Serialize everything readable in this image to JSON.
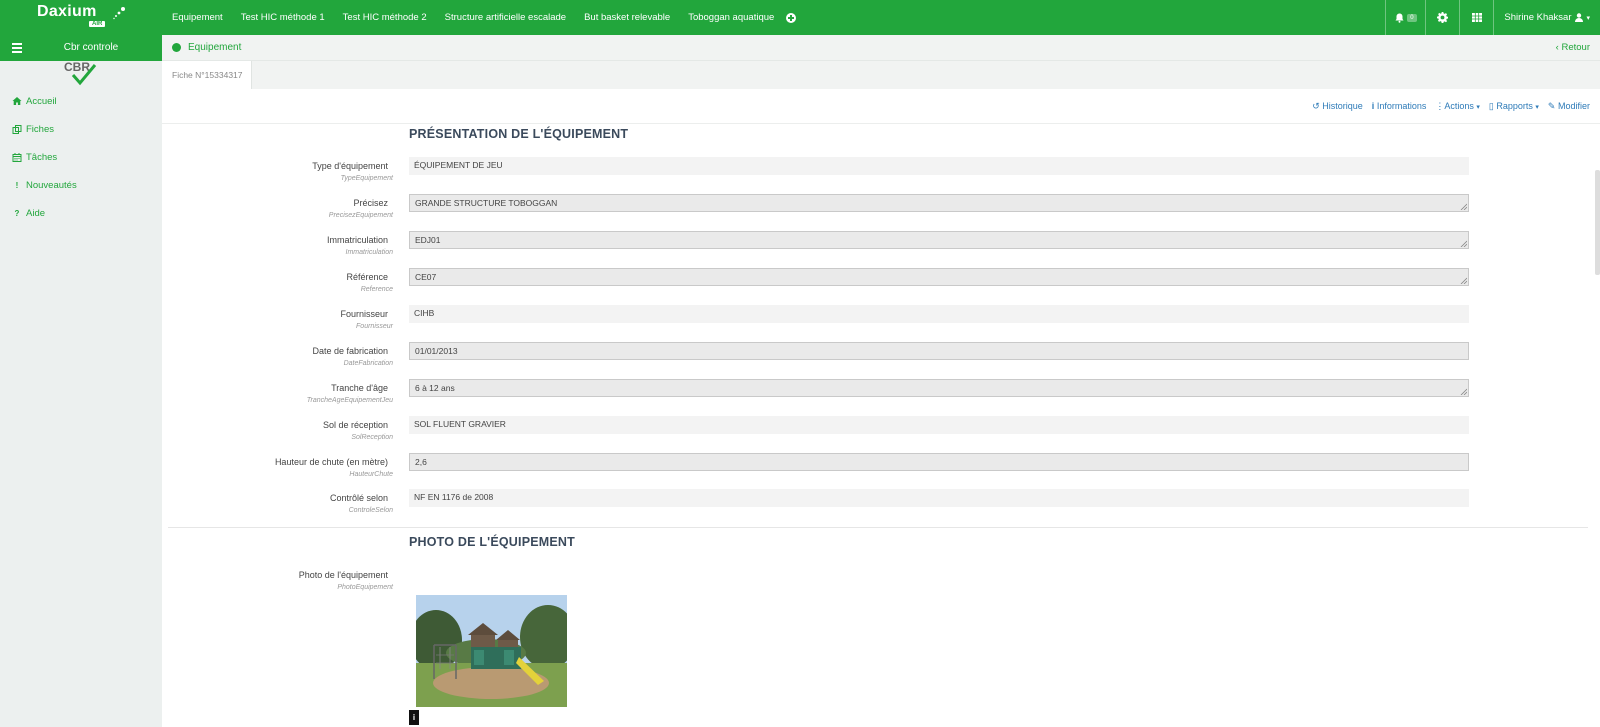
{
  "header": {
    "logo_text": "Daxium",
    "logo_badge": "AIR",
    "nav": [
      "Equipement",
      "Test HIC méthode 1",
      "Test HIC méthode 2",
      "Structure artificielle escalade",
      "But basket relevable",
      "Toboggan aquatique"
    ],
    "notification_count": "0",
    "user_name": "Shirine Khaksar"
  },
  "sidebar": {
    "company": "Cbr controle",
    "logo_text": "CBR",
    "items": [
      {
        "label": "Accueil",
        "icon": "home-icon"
      },
      {
        "label": "Fiches",
        "icon": "copy-icon"
      },
      {
        "label": "Tâches",
        "icon": "calendar-icon"
      },
      {
        "label": "Nouveautés",
        "icon": "exclamation-icon"
      },
      {
        "label": "Aide",
        "icon": "question-icon"
      }
    ]
  },
  "breadcrumb": {
    "title": "Equipement",
    "back": "Retour"
  },
  "record": {
    "tab": "Fiche N°15334317"
  },
  "actions": {
    "historique": "Historique",
    "informations": "Informations",
    "actions": "Actions",
    "rapports": "Rapports",
    "modifier": "Modifier"
  },
  "section1": {
    "title": "PRÉSENTATION DE L'ÉQUIPEMENT",
    "fields": [
      {
        "label": "Type d'équipement",
        "sub": "TypeEquipement",
        "value": "ÉQUIPEMENT DE JEU"
      },
      {
        "label": "Précisez",
        "sub": "PrecisezEquipement",
        "value": "GRANDE STRUCTURE TOBOGGAN"
      },
      {
        "label": "Immatriculation",
        "sub": "Immatriculation",
        "value": "EDJ01"
      },
      {
        "label": "Référence",
        "sub": "Reference",
        "value": "CE07"
      },
      {
        "label": "Fournisseur",
        "sub": "Fournisseur",
        "value": "CIHB"
      },
      {
        "label": "Date de fabrication",
        "sub": "DateFabrication",
        "value": "01/01/2013"
      },
      {
        "label": "Tranche d'âge",
        "sub": "TrancheAgeEquipementJeu",
        "value": "6 à 12 ans"
      },
      {
        "label": "Sol de réception",
        "sub": "SolReception",
        "value": "SOL FLUENT GRAVIER"
      },
      {
        "label": "Hauteur de chute (en mètre)",
        "sub": "HauteurChute",
        "value": "2,6"
      },
      {
        "label": "Contrôlé selon",
        "sub": "ControleSelon",
        "value": "NF EN 1176 de 2008"
      }
    ]
  },
  "section2": {
    "title": "PHOTO DE L'ÉQUIPEMENT",
    "photo_label": "Photo de l'équipement",
    "photo_sub": "PhotoEquipement"
  },
  "colors": {
    "brand": "#22a63c",
    "link": "#2e7bb8",
    "sidebar_bg": "#ecf0ef"
  }
}
